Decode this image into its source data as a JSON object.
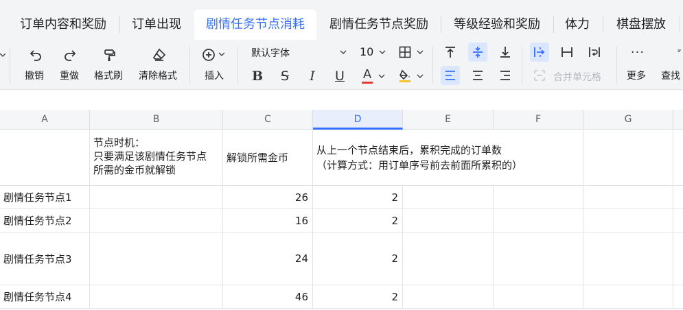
{
  "sheet_tabs": [
    {
      "label": "订单内容和奖励",
      "active": false
    },
    {
      "label": "订单出现",
      "active": false
    },
    {
      "label": "剧情任务节点消耗",
      "active": true
    },
    {
      "label": "剧情任务节点奖励",
      "active": false
    },
    {
      "label": "等级经验和奖励",
      "active": false
    },
    {
      "label": "体力",
      "active": false
    },
    {
      "label": "棋盘摆放",
      "active": false
    }
  ],
  "toolbar": {
    "undo": "撤销",
    "redo": "重做",
    "format_painter": "格式刷",
    "clear_format": "清除格式",
    "insert": "插入",
    "font_family": "默认字体",
    "font_size": "10",
    "text_color_letter": "A",
    "merge_cells": "合并单元格",
    "more": "更多",
    "find": "查找"
  },
  "colors": {
    "accent": "#3370ff",
    "text_color_underline": "#e53935",
    "fill_color_underline": "#fbc02d"
  },
  "columns": [
    "A",
    "B",
    "C",
    "D",
    "E",
    "F",
    "G"
  ],
  "header_row": {
    "b": "节点时机：\n只要满足该剧情任务节点\n所需的金币就解锁",
    "c": "解锁所需金币",
    "d": "从上一个节点结束后，累积完成的订单数\n（计算方式：用订单序号前去前面所累积的）"
  },
  "rows": [
    {
      "name": "剧情任务节点1",
      "coins": "26",
      "orders": "2"
    },
    {
      "name": "剧情任务节点2",
      "coins": "16",
      "orders": "2"
    },
    {
      "name": "剧情任务节点3",
      "coins": "24",
      "orders": "2"
    },
    {
      "name": "剧情任务节点4",
      "coins": "46",
      "orders": "2"
    }
  ]
}
